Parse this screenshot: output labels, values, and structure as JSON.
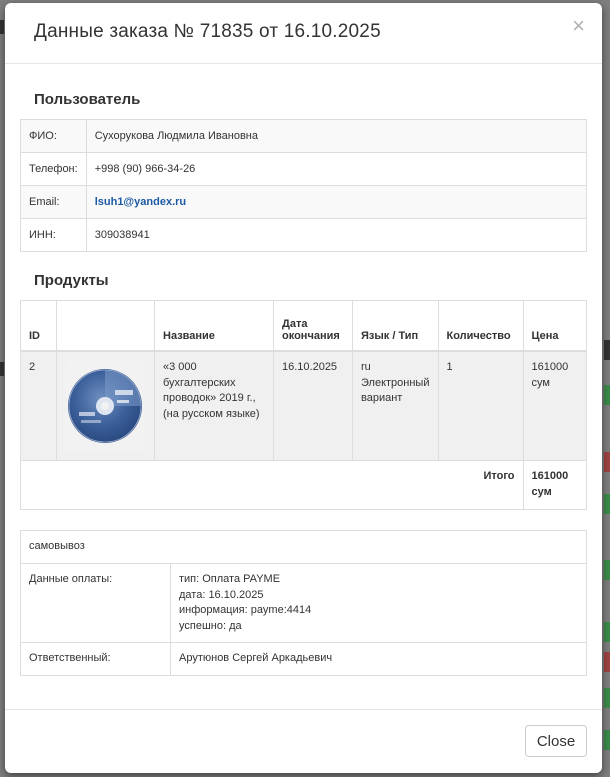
{
  "modal": {
    "title": "Данные заказа № 71835 от 16.10.2025",
    "close_icon": "×",
    "close_button": "Close"
  },
  "user": {
    "section_title": "Пользователь",
    "rows": [
      {
        "label": "ФИО:",
        "value": "Сухорукова Людмила Ивановна"
      },
      {
        "label": "Телефон:",
        "value": "+998 (90) 966-34-26"
      },
      {
        "label": "Email:",
        "value": "lsuh1@yandex.ru"
      },
      {
        "label": "ИНН:",
        "value": "309038941"
      }
    ]
  },
  "products": {
    "section_title": "Продукты",
    "headers": {
      "id": "ID",
      "image": "",
      "name": "Название",
      "end_date_1": "Дата",
      "end_date_2": "окончания",
      "lang_type": "Язык / Тип",
      "quantity": "Количество",
      "price": "Цена"
    },
    "items": [
      {
        "id": "2",
        "image_icon": "cd-disc-icon",
        "name": "«3 000 бухгалтерских проводок» 2019 г., (на русском языке)",
        "end_date": "16.10.2025",
        "lang": "ru",
        "type": "Электронный вариант",
        "quantity": "1",
        "price": "161000 сум"
      }
    ],
    "total_label": "Итого",
    "total_value": "161000 сум"
  },
  "payment": {
    "delivery": "самовывоз",
    "payment_label": "Данные оплаты:",
    "payment_lines": [
      "тип: Оплата PAYME",
      "дата: 16.10.2025",
      "информация: payme:4414",
      "успешно: да"
    ],
    "responsible_label": "Ответственный:",
    "responsible_value": "Арутюнов Сергей Аркадьевич"
  },
  "colors": {
    "link": "#1c5aa6",
    "backdrop": "rgba(0,0,0,0.5)"
  }
}
